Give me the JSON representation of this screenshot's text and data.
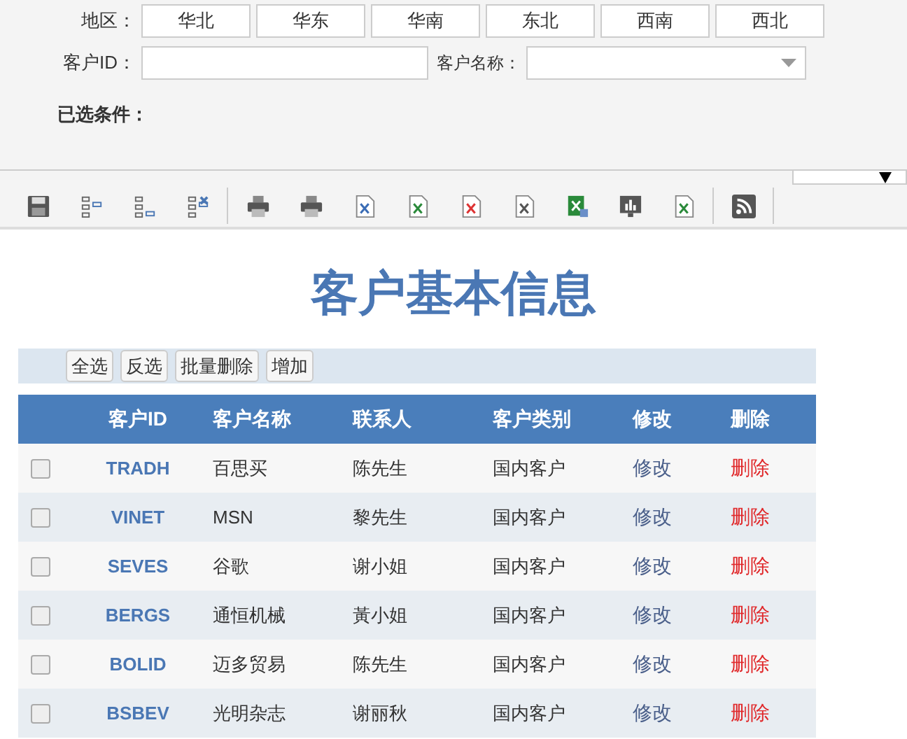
{
  "filters": {
    "region_label": "地区：",
    "regions": [
      {
        "label": "华北",
        "selected": false
      },
      {
        "label": "华东",
        "selected": false
      },
      {
        "label": "华南",
        "selected": false
      },
      {
        "label": "东北",
        "selected": false
      },
      {
        "label": "西南",
        "selected": false
      },
      {
        "label": "西北",
        "selected": false
      }
    ],
    "customer_id_label": "客户ID：",
    "customer_name_label": "客户名称：",
    "selected_conditions_label": "已选条件："
  },
  "page_title": "客户基本信息",
  "actions": [
    "全选",
    "反选",
    "批量删除",
    "增加"
  ],
  "table": {
    "columns": [
      "客户ID",
      "客户名称",
      "联系人",
      "客户类别",
      "修改",
      "删除"
    ],
    "rows": [
      {
        "checked": false,
        "id": "TRADH",
        "name": "百思买",
        "contact": "陈先生",
        "category": "国内客户",
        "edit": "修改",
        "delete": "删除"
      },
      {
        "checked": false,
        "id": "VINET",
        "name": "MSN",
        "contact": "黎先生",
        "category": "国内客户",
        "edit": "修改",
        "delete": "删除"
      },
      {
        "checked": false,
        "id": "SEVES",
        "name": "谷歌",
        "contact": "谢小姐",
        "category": "国内客户",
        "edit": "修改",
        "delete": "删除"
      },
      {
        "checked": false,
        "id": "BERGS",
        "name": "通恒机械",
        "contact": "黃小姐",
        "category": "国内客户",
        "edit": "修改",
        "delete": "删除"
      },
      {
        "checked": false,
        "id": "BOLID",
        "name": "迈多贸易",
        "contact": "陈先生",
        "category": "国内客户",
        "edit": "修改",
        "delete": "删除"
      },
      {
        "checked": false,
        "id": "BSBEV",
        "name": "光明杂志",
        "contact": "谢丽秋",
        "category": "国内客户",
        "edit": "修改",
        "delete": "删除"
      }
    ]
  }
}
